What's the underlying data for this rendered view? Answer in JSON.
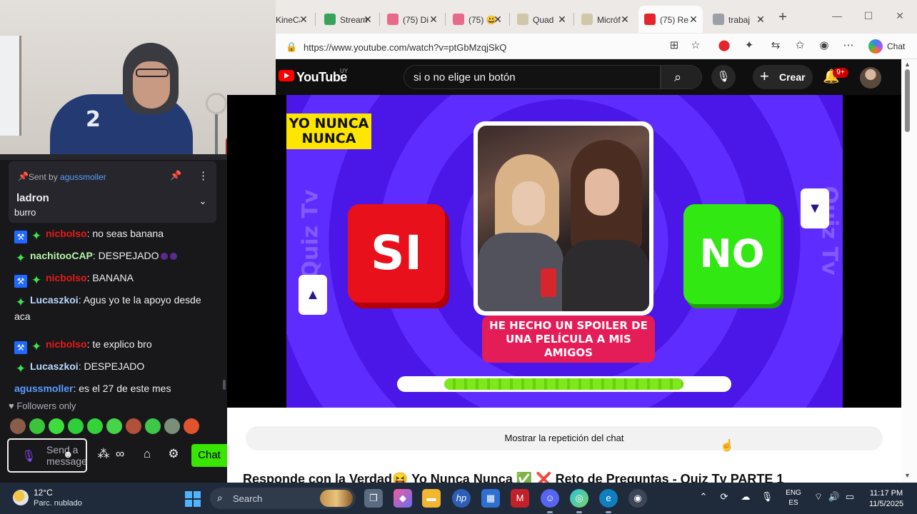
{
  "chat": {
    "pinned": {
      "sent_by_prefix": "Sent by",
      "sent_by_user": "agussmoller",
      "message": "ladron",
      "previous_tail": "burro"
    },
    "messages": [
      {
        "badges": [
          "mod",
          "sub"
        ],
        "user": "nicbolso",
        "color": "#e91916",
        "text": ": no seas banana"
      },
      {
        "badges": [
          "sub"
        ],
        "user": "nachitooCAP",
        "color": "#b5f5a6",
        "text": ": DESPEJADO"
      },
      {
        "badges": [
          "mod",
          "sub"
        ],
        "user": "nicbolso",
        "color": "#e91916",
        "text": ": BANANA"
      },
      {
        "badges": [
          "sub"
        ],
        "user": "Lucaszkoi",
        "color": "#b9d8ff",
        "text": ": Agus yo te la apoyo desde aca"
      },
      {
        "badges": [
          "mod",
          "sub"
        ],
        "user": "nicbolso",
        "color": "#e91916",
        "text": ": te explico bro"
      },
      {
        "badges": [
          "sub"
        ],
        "user": "Lucaszkoi",
        "color": "#b9d8ff",
        "text": ": DESPEJADO"
      },
      {
        "badges": [],
        "user": "agussmoller",
        "color": "#5c9cff",
        "text": ": es el 27 de este mes"
      }
    ],
    "followers_label": "Followers only",
    "emote_colors": [
      "#8a5d4a",
      "#39c43a",
      "#3fdc3f",
      "#2fcf3a",
      "#35d33a",
      "#46d44a",
      "#b3503a",
      "#3ec84a",
      "#7a8f7a",
      "#e0532f"
    ],
    "input_placeholder": "Send a message",
    "chat_button": "Chat"
  },
  "browser": {
    "tabs": [
      {
        "title": "KineCa",
        "favicon": "#d9d9d9",
        "active": false
      },
      {
        "title": "Stream",
        "favicon": "#3aa35a",
        "active": false
      },
      {
        "title": "(75) Di",
        "favicon": "#e86a8a",
        "active": false
      },
      {
        "title": "(75) 😃",
        "favicon": "#e86a8a",
        "active": false
      },
      {
        "title": "Quad",
        "favicon": "#cfc7a8",
        "active": false
      },
      {
        "title": "Micróf",
        "favicon": "#cfc7a8",
        "active": false
      },
      {
        "title": "(75) Re",
        "favicon": "#e4262c",
        "active": true
      },
      {
        "title": "trabaj",
        "favicon": "#9aa0a6",
        "active": false
      }
    ],
    "url": "https://www.youtube.com/watch?v=ptGbMzqjSkQ",
    "copilot_label": "Chat"
  },
  "youtube": {
    "logo_text": "YouTube",
    "country": "UY",
    "search_query": "si o no elige un botón",
    "create_label": "Crear",
    "notif_count": "9+",
    "video": {
      "game_title": "YO NUNCA NUNCA",
      "watermark": "Quiz Tv",
      "yes_label": "SI",
      "no_label": "NO",
      "caption": "HE HECHO UN SPOILER DE UNA PELÍCULA A MIS AMIGOS",
      "timer_fraction": 0.71
    },
    "replay_button": "Mostrar la repetición del chat",
    "video_title": "Responde con la Verdad😝 Yo Nunca Nunca ✅ ❌ Reto de Preguntas - Quiz Tv PARTE 1"
  },
  "taskbar": {
    "weather_temp": "12°C",
    "weather_desc": "Parc. nublado",
    "search_placeholder": "Search",
    "lang_top": "ENG",
    "lang_bottom": "ES",
    "time": "11:17 PM",
    "date": "11/5/2025"
  }
}
